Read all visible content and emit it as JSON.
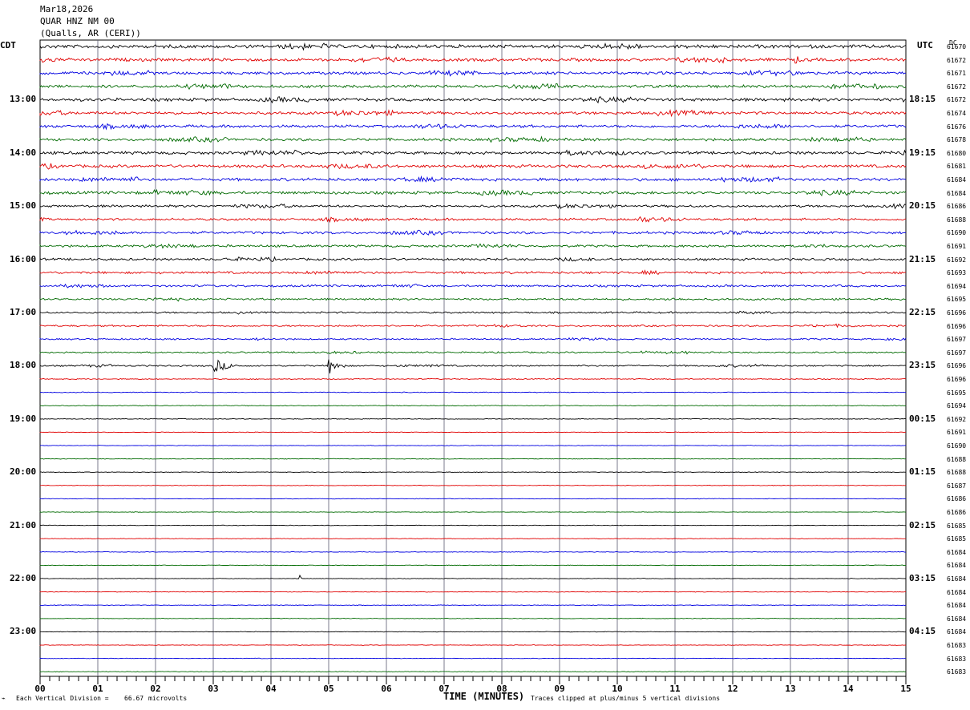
{
  "header": {
    "date": "Mar18,2026",
    "station": "QUAR HNZ NM 00",
    "location": "(Qualls, AR (CERI))"
  },
  "chart_data": {
    "type": "helicorder",
    "left_timezone": "CDT",
    "right_timezone": "UTC",
    "dc_header": "DC",
    "xlabel": "TIME (MINUTES)",
    "x_ticks": [
      "00",
      "01",
      "02",
      "03",
      "04",
      "05",
      "06",
      "07",
      "08",
      "09",
      "10",
      "11",
      "12",
      "13",
      "14",
      "15"
    ],
    "xlim": [
      0,
      15
    ],
    "left_labels": [
      "13:00",
      "14:00",
      "15:00",
      "16:00",
      "17:00",
      "18:00",
      "19:00",
      "20:00",
      "21:00",
      "22:00",
      "23:00"
    ],
    "right_labels": [
      "18:15",
      "19:15",
      "20:15",
      "21:15",
      "22:15",
      "23:15",
      "00:15",
      "01:15",
      "02:15",
      "03:15",
      "04:15"
    ],
    "trace_colors": [
      "#000000",
      "#e00000",
      "#0000e0",
      "#006a00"
    ],
    "traces_per_hour": 4,
    "dc_offsets": [
      61670,
      61672,
      61671,
      61672,
      61672,
      61674,
      61676,
      61678,
      61680,
      61681,
      61684,
      61684,
      61686,
      61688,
      61690,
      61691,
      61692,
      61693,
      61694,
      61695,
      61696,
      61696,
      61697,
      61697,
      61696,
      61696,
      61695,
      61694,
      61692,
      61691,
      61690,
      61688,
      61688,
      61687,
      61686,
      61686,
      61685,
      61685,
      61684,
      61684,
      61684,
      61684,
      61684,
      61684,
      61684,
      61683,
      61683,
      61683
    ],
    "activity": [
      1.8,
      1.6,
      1.5,
      1.5,
      1.6,
      1.5,
      1.4,
      1.4,
      1.5,
      1.5,
      1.5,
      1.5,
      1.2,
      1.2,
      1.3,
      1.2,
      1.2,
      1.2,
      1.1,
      1.0,
      0.9,
      0.9,
      0.8,
      0.8,
      0.8,
      0.5,
      0.4,
      0.4,
      0.4,
      0.3,
      0.3,
      0.3,
      0.3,
      0.3,
      0.3,
      0.3,
      0.3,
      0.3,
      0.3,
      0.3,
      0.3,
      0.3,
      0.3,
      0.3,
      0.3,
      0.3,
      0.3,
      0.3
    ],
    "events": [
      {
        "trace": 24,
        "minute": 3.0,
        "amplitude": 10,
        "duration": 0.5
      },
      {
        "trace": 24,
        "minute": 5.0,
        "amplitude": 11,
        "duration": 0.35
      },
      {
        "trace": 40,
        "minute": 4.5,
        "amplitude": 6,
        "duration": 0.04
      },
      {
        "trace": 13,
        "minute": 10.4,
        "amplitude": 5,
        "duration": 0.6
      },
      {
        "trace": 0,
        "minute": 4.9,
        "amplitude": 6,
        "duration": 0.2
      },
      {
        "trace": 1,
        "minute": 13.1,
        "amplitude": 5,
        "duration": 0.3
      }
    ],
    "vertical_division": "66.67",
    "footer_left": "Each Vertical Division =",
    "footer_units": "microvolts",
    "footer_right": "Traces clipped at plus/minus 5 vertical divisions"
  }
}
